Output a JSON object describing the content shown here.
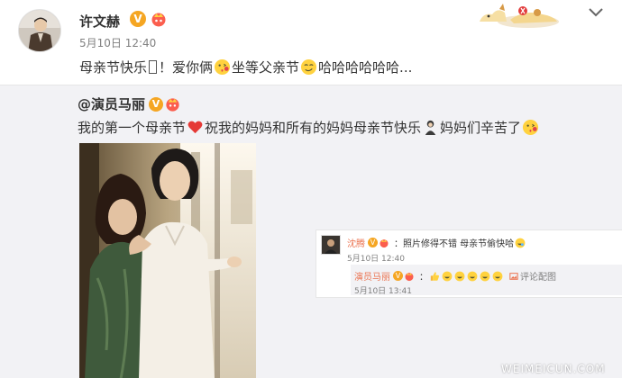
{
  "post": {
    "author": "许文赫",
    "vip_badge": "V",
    "timestamp": "5月10日 12:40",
    "text_part1": "母亲节快乐",
    "text_part2": "！爱你俩",
    "text_part3": " 坐等父亲节",
    "text_part4": "哈哈哈哈哈哈..."
  },
  "repost": {
    "author": "@演员马丽",
    "vip_badge": "V",
    "text_part1": "我的第一个母亲节",
    "text_part2": "祝我的妈妈和所有的妈妈母亲节快乐",
    "text_part3": "妈妈们辛苦了"
  },
  "comment": {
    "author": "沈腾",
    "badge": "V",
    "text_part1": "：照片修得不错 母亲节偷快哈",
    "timestamp": "5月10日 12:40",
    "reply": {
      "author": "演员马丽",
      "badge": "V",
      "text_part1": "：",
      "report_label": "评论配图",
      "timestamp": "5月10日 13:41"
    }
  },
  "watermark": "WEIMEICUN.COM",
  "colors": {
    "accent_orange": "#eb7350",
    "vip_gold": "#f5a623",
    "repost_bg": "#f2f2f5"
  }
}
